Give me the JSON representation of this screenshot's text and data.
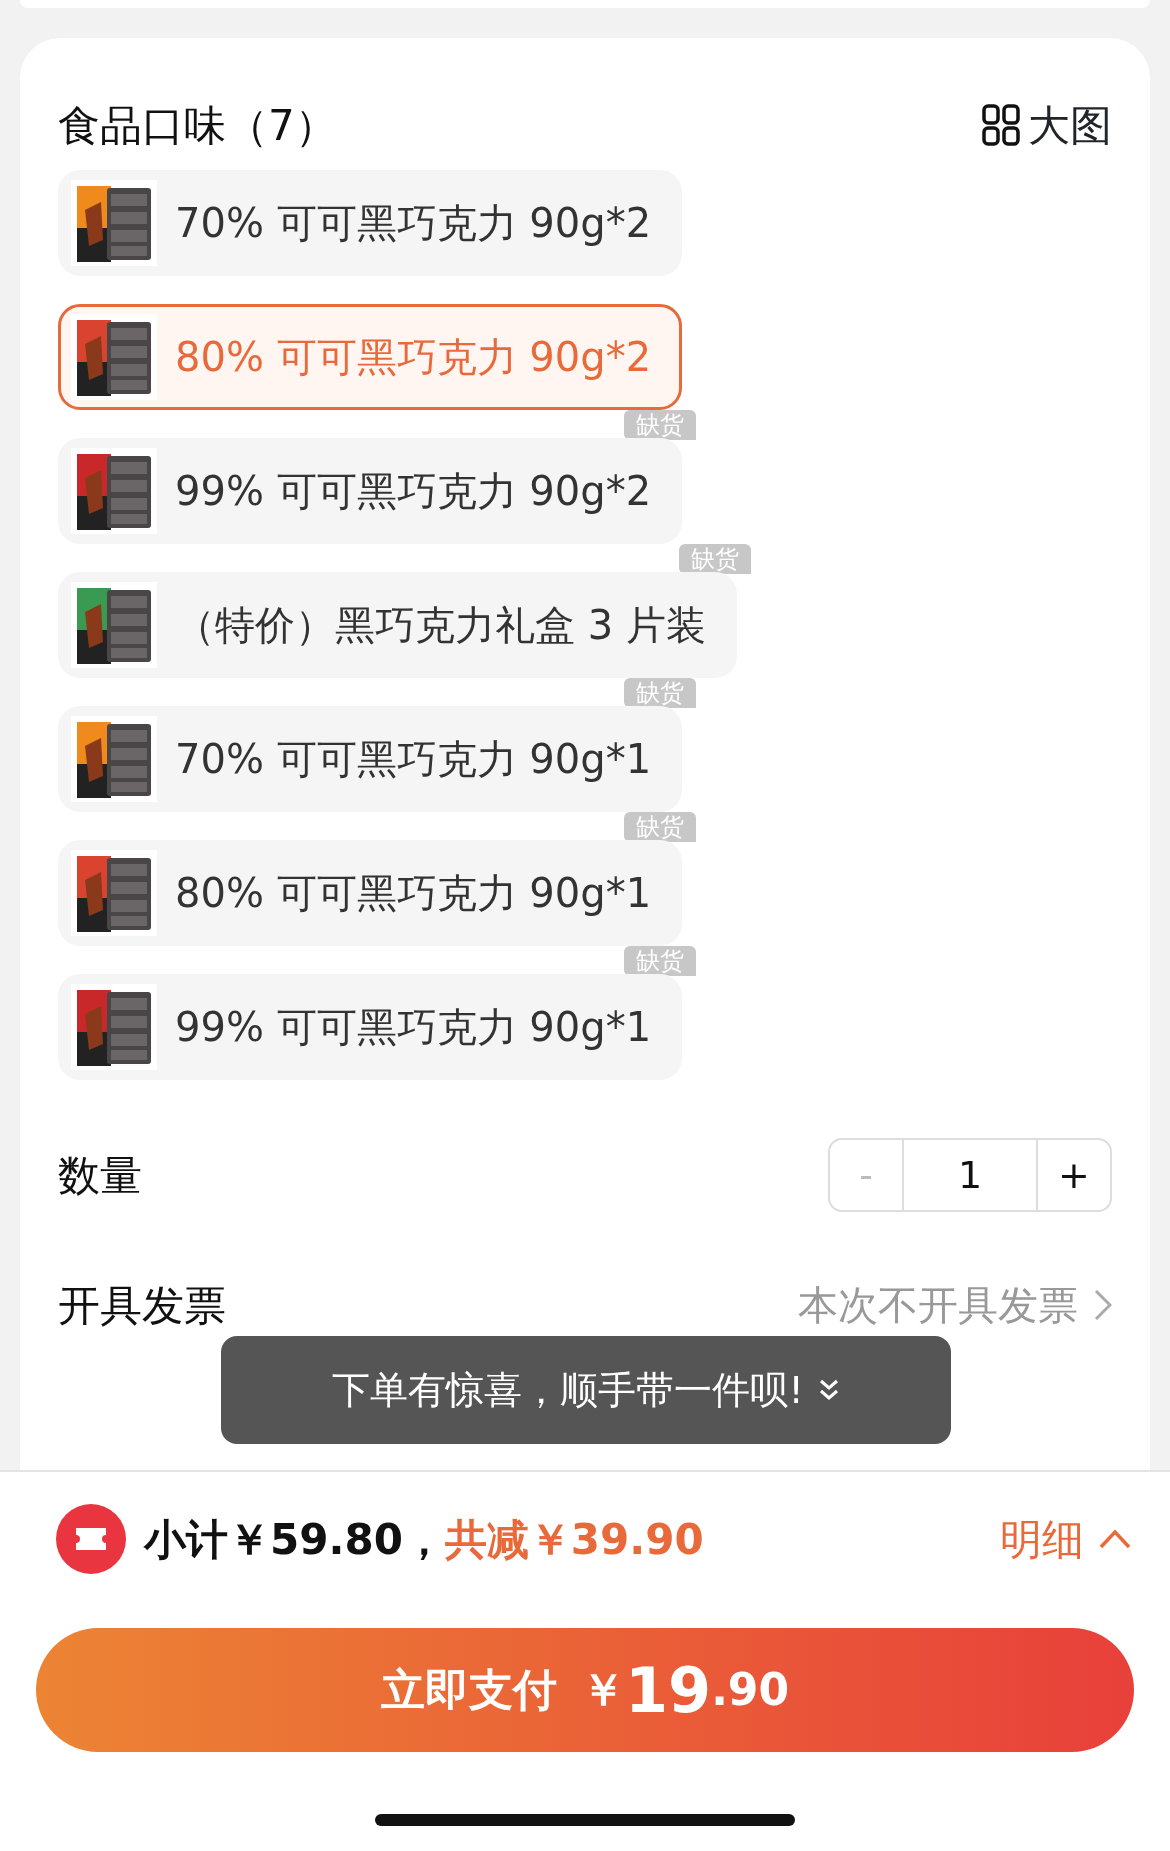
{
  "section": {
    "title": "食品口味（7）",
    "view_toggle": "大图"
  },
  "options": [
    {
      "label": "70% 可可黑巧克力 90g*2",
      "selected": false
    },
    {
      "label": "80% 可可黑巧克力 90g*2",
      "selected": true
    },
    {
      "label": "99% 可可黑巧克力 90g*2",
      "selected": false,
      "badge": "缺货"
    },
    {
      "label": "（特价）黑巧克力礼盒 3 片装",
      "selected": false,
      "badge": "缺货"
    },
    {
      "label": "70% 可可黑巧克力 90g*1",
      "selected": false,
      "badge": "缺货"
    },
    {
      "label": "80% 可可黑巧克力 90g*1",
      "selected": false,
      "badge": "缺货"
    },
    {
      "label": "99% 可可黑巧克力 90g*1",
      "selected": false,
      "badge": "缺货"
    }
  ],
  "quantity": {
    "label": "数量",
    "minus": "-",
    "value": "1",
    "plus": "+",
    "minus_disabled": true
  },
  "invoice": {
    "label": "开具发票",
    "value": "本次不开具发票"
  },
  "toast": {
    "text": "下单有惊喜，顺手带一件呗!"
  },
  "summary": {
    "subtotal": "小计￥59.80，",
    "discount": "共减￥39.90",
    "details": "明细"
  },
  "pay_button": {
    "label": "立即支付",
    "currency": "￥",
    "amount_int": "19",
    "amount_dec": ".90"
  }
}
